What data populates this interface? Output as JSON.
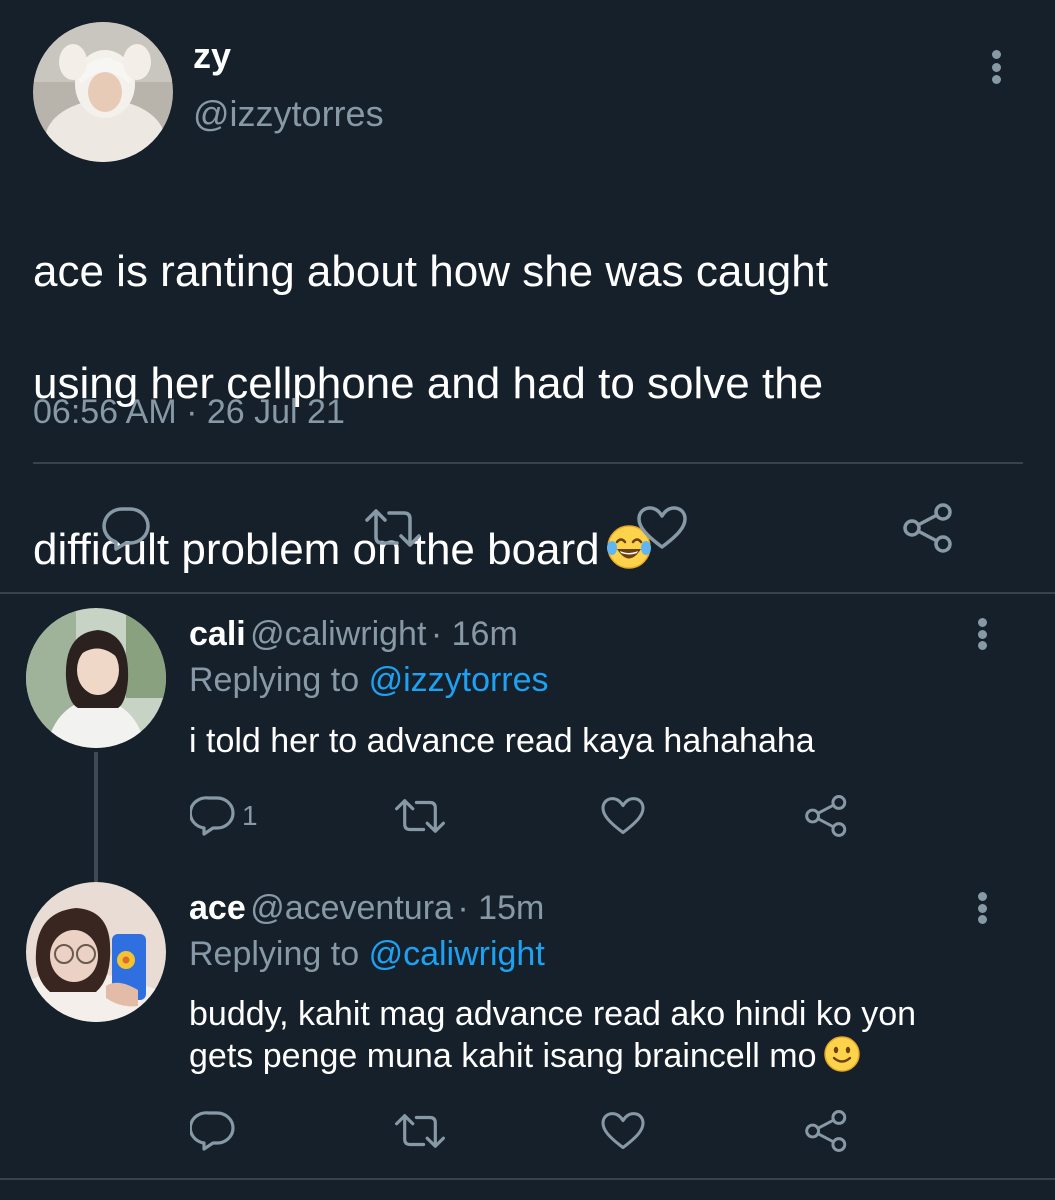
{
  "main_tweet": {
    "author_name": "zy",
    "author_handle": "@izzytorres",
    "text_line1": "ace is ranting about how she was caught",
    "text_line2": "using her cellphone and had to solve the",
    "text_line3": "difficult problem on the board",
    "text_emoji": "😂",
    "timestamp": "06:56 AM · 26 Jul 21",
    "avatar_icon": "avatar-photo",
    "more_icon": "more-vertical-icon"
  },
  "replies": [
    {
      "author_name": "cali",
      "author_handle": "@caliwright",
      "time": "· 16m",
      "replying_prefix": "Replying to",
      "replying_to": "@izzytorres",
      "text": "i told her to advance read kaya hahahaha",
      "reply_count": "1"
    },
    {
      "author_name": "ace",
      "author_handle": "@aceventura",
      "time": "· 15m",
      "replying_prefix": "Replying to",
      "replying_to": "@caliwright",
      "text_line1": "buddy, kahit mag advance read ako hindi ko yon",
      "text_line2": "gets penge muna kahit isang braincell mo",
      "text_emoji": "🙂",
      "reply_count": ""
    }
  ],
  "actions": [
    "reply-icon",
    "retweet-icon",
    "like-icon",
    "share-icon"
  ],
  "colors": {
    "background": "#15202b",
    "secondary_text": "#8899a6",
    "mention": "#1da1f2",
    "divider": "#38444d"
  }
}
